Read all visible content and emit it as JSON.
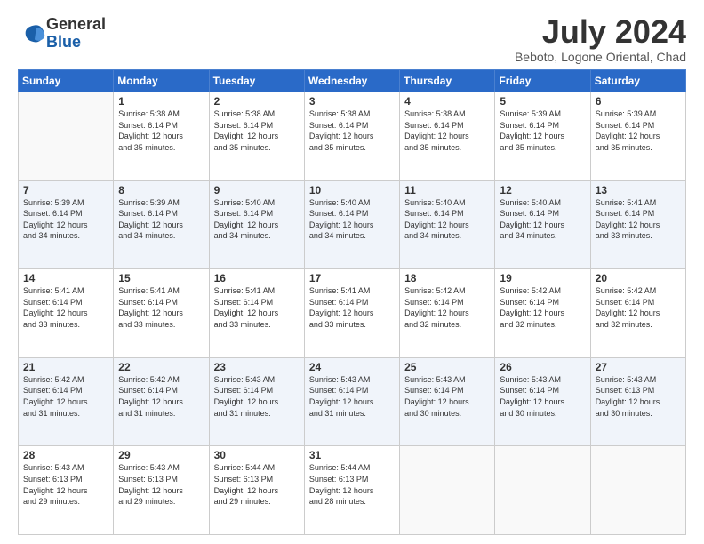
{
  "logo": {
    "general": "General",
    "blue": "Blue"
  },
  "title": "July 2024",
  "location": "Beboto, Logone Oriental, Chad",
  "days_header": [
    "Sunday",
    "Monday",
    "Tuesday",
    "Wednesday",
    "Thursday",
    "Friday",
    "Saturday"
  ],
  "weeks": [
    [
      {
        "day": "",
        "info": ""
      },
      {
        "day": "1",
        "info": "Sunrise: 5:38 AM\nSunset: 6:14 PM\nDaylight: 12 hours\nand 35 minutes."
      },
      {
        "day": "2",
        "info": "Sunrise: 5:38 AM\nSunset: 6:14 PM\nDaylight: 12 hours\nand 35 minutes."
      },
      {
        "day": "3",
        "info": "Sunrise: 5:38 AM\nSunset: 6:14 PM\nDaylight: 12 hours\nand 35 minutes."
      },
      {
        "day": "4",
        "info": "Sunrise: 5:38 AM\nSunset: 6:14 PM\nDaylight: 12 hours\nand 35 minutes."
      },
      {
        "day": "5",
        "info": "Sunrise: 5:39 AM\nSunset: 6:14 PM\nDaylight: 12 hours\nand 35 minutes."
      },
      {
        "day": "6",
        "info": "Sunrise: 5:39 AM\nSunset: 6:14 PM\nDaylight: 12 hours\nand 35 minutes."
      }
    ],
    [
      {
        "day": "7",
        "info": "Sunrise: 5:39 AM\nSunset: 6:14 PM\nDaylight: 12 hours\nand 34 minutes."
      },
      {
        "day": "8",
        "info": "Sunrise: 5:39 AM\nSunset: 6:14 PM\nDaylight: 12 hours\nand 34 minutes."
      },
      {
        "day": "9",
        "info": "Sunrise: 5:40 AM\nSunset: 6:14 PM\nDaylight: 12 hours\nand 34 minutes."
      },
      {
        "day": "10",
        "info": "Sunrise: 5:40 AM\nSunset: 6:14 PM\nDaylight: 12 hours\nand 34 minutes."
      },
      {
        "day": "11",
        "info": "Sunrise: 5:40 AM\nSunset: 6:14 PM\nDaylight: 12 hours\nand 34 minutes."
      },
      {
        "day": "12",
        "info": "Sunrise: 5:40 AM\nSunset: 6:14 PM\nDaylight: 12 hours\nand 34 minutes."
      },
      {
        "day": "13",
        "info": "Sunrise: 5:41 AM\nSunset: 6:14 PM\nDaylight: 12 hours\nand 33 minutes."
      }
    ],
    [
      {
        "day": "14",
        "info": "Sunrise: 5:41 AM\nSunset: 6:14 PM\nDaylight: 12 hours\nand 33 minutes."
      },
      {
        "day": "15",
        "info": "Sunrise: 5:41 AM\nSunset: 6:14 PM\nDaylight: 12 hours\nand 33 minutes."
      },
      {
        "day": "16",
        "info": "Sunrise: 5:41 AM\nSunset: 6:14 PM\nDaylight: 12 hours\nand 33 minutes."
      },
      {
        "day": "17",
        "info": "Sunrise: 5:41 AM\nSunset: 6:14 PM\nDaylight: 12 hours\nand 33 minutes."
      },
      {
        "day": "18",
        "info": "Sunrise: 5:42 AM\nSunset: 6:14 PM\nDaylight: 12 hours\nand 32 minutes."
      },
      {
        "day": "19",
        "info": "Sunrise: 5:42 AM\nSunset: 6:14 PM\nDaylight: 12 hours\nand 32 minutes."
      },
      {
        "day": "20",
        "info": "Sunrise: 5:42 AM\nSunset: 6:14 PM\nDaylight: 12 hours\nand 32 minutes."
      }
    ],
    [
      {
        "day": "21",
        "info": "Sunrise: 5:42 AM\nSunset: 6:14 PM\nDaylight: 12 hours\nand 31 minutes."
      },
      {
        "day": "22",
        "info": "Sunrise: 5:42 AM\nSunset: 6:14 PM\nDaylight: 12 hours\nand 31 minutes."
      },
      {
        "day": "23",
        "info": "Sunrise: 5:43 AM\nSunset: 6:14 PM\nDaylight: 12 hours\nand 31 minutes."
      },
      {
        "day": "24",
        "info": "Sunrise: 5:43 AM\nSunset: 6:14 PM\nDaylight: 12 hours\nand 31 minutes."
      },
      {
        "day": "25",
        "info": "Sunrise: 5:43 AM\nSunset: 6:14 PM\nDaylight: 12 hours\nand 30 minutes."
      },
      {
        "day": "26",
        "info": "Sunrise: 5:43 AM\nSunset: 6:14 PM\nDaylight: 12 hours\nand 30 minutes."
      },
      {
        "day": "27",
        "info": "Sunrise: 5:43 AM\nSunset: 6:13 PM\nDaylight: 12 hours\nand 30 minutes."
      }
    ],
    [
      {
        "day": "28",
        "info": "Sunrise: 5:43 AM\nSunset: 6:13 PM\nDaylight: 12 hours\nand 29 minutes."
      },
      {
        "day": "29",
        "info": "Sunrise: 5:43 AM\nSunset: 6:13 PM\nDaylight: 12 hours\nand 29 minutes."
      },
      {
        "day": "30",
        "info": "Sunrise: 5:44 AM\nSunset: 6:13 PM\nDaylight: 12 hours\nand 29 minutes."
      },
      {
        "day": "31",
        "info": "Sunrise: 5:44 AM\nSunset: 6:13 PM\nDaylight: 12 hours\nand 28 minutes."
      },
      {
        "day": "",
        "info": ""
      },
      {
        "day": "",
        "info": ""
      },
      {
        "day": "",
        "info": ""
      }
    ]
  ]
}
